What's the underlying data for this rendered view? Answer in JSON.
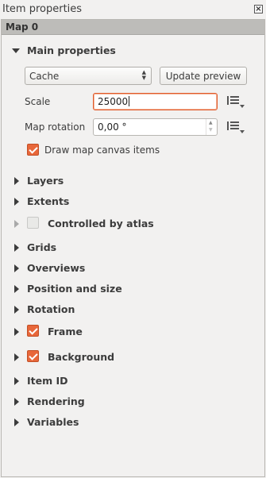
{
  "window": {
    "title": "Item properties",
    "close_glyph": "×"
  },
  "item_bar": {
    "label": "Map 0"
  },
  "main_properties": {
    "label": "Main properties",
    "preview_combo": {
      "value": "Cache"
    },
    "update_preview_label": "Update preview",
    "scale": {
      "label": "Scale",
      "value": "25000"
    },
    "map_rotation": {
      "label": "Map rotation",
      "value": "0,00 °"
    },
    "draw_canvas_items": {
      "label": "Draw map canvas items",
      "checked": true
    }
  },
  "sections": [
    {
      "label": "Layers"
    },
    {
      "label": "Extents"
    },
    {
      "label": "Controlled by atlas",
      "checkbox": false
    },
    {
      "label": "Grids"
    },
    {
      "label": "Overviews"
    },
    {
      "label": "Position and size"
    },
    {
      "label": "Rotation"
    },
    {
      "label": "Frame",
      "checkbox": true
    },
    {
      "label": "Background",
      "checkbox": true
    },
    {
      "label": "Item ID"
    },
    {
      "label": "Rendering"
    },
    {
      "label": "Variables"
    }
  ],
  "colors": {
    "accent": "#e8673a",
    "focus_border": "#e05a2a",
    "item_bar": "#bdbcb9",
    "background": "#f2f1f0"
  },
  "icons": {
    "expanded": "triangle-down-icon",
    "collapsed": "triangle-right-icon",
    "data_defined": "data-defined-override-icon"
  }
}
